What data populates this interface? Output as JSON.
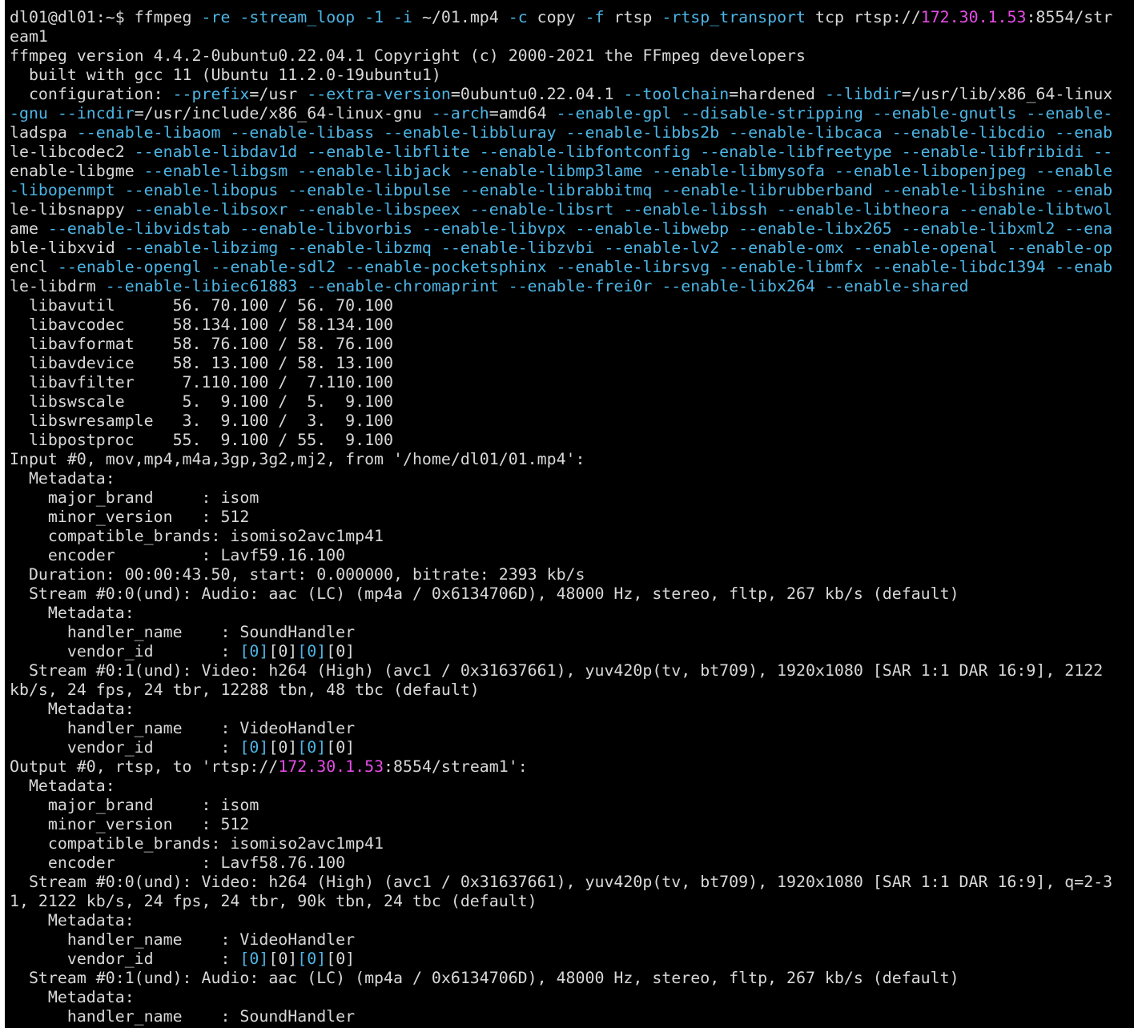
{
  "window": {
    "app": "terminal"
  },
  "colors": {
    "background": "#000000",
    "text": "#d8d8d8",
    "option_highlight": "#4cb6e6",
    "ip_highlight": "#e64ce6"
  },
  "terminal": {
    "lines": [
      [
        {
          "t": "dl01@dl01:~$ ffmpeg "
        },
        {
          "t": "-re -stream_loop -1 -i",
          "c": "opt"
        },
        {
          "t": " ~/01.mp4 "
        },
        {
          "t": "-c",
          "c": "opt"
        },
        {
          "t": " copy "
        },
        {
          "t": "-f",
          "c": "opt"
        },
        {
          "t": " rtsp "
        },
        {
          "t": "-rtsp_transport",
          "c": "opt"
        },
        {
          "t": " tcp rtsp://"
        },
        {
          "t": "172.30.1.53",
          "c": "ip"
        },
        {
          "t": ":8554/str"
        }
      ],
      [
        {
          "t": "eam1"
        }
      ],
      [
        {
          "t": "ffmpeg version 4.4.2-0ubuntu0.22.04.1 Copyright (c) 2000-2021 the FFmpeg developers"
        }
      ],
      [
        {
          "t": "  built with gcc 11 (Ubuntu 11.2.0-19ubuntu1)"
        }
      ],
      [
        {
          "t": "  configuration: "
        },
        {
          "t": "--prefix",
          "c": "opt"
        },
        {
          "t": "=/usr "
        },
        {
          "t": "--extra-version",
          "c": "opt"
        },
        {
          "t": "=0ubuntu0.22.04.1 "
        },
        {
          "t": "--toolchain",
          "c": "opt"
        },
        {
          "t": "=hardened "
        },
        {
          "t": "--libdir",
          "c": "opt"
        },
        {
          "t": "=/usr/lib/x86_64-linux"
        }
      ],
      [
        {
          "t": "-gnu --incdir",
          "c": "opt"
        },
        {
          "t": "=/usr/include/x86_64-linux-gnu "
        },
        {
          "t": "--arch",
          "c": "opt"
        },
        {
          "t": "=amd64 "
        },
        {
          "t": "--enable-gpl --disable-stripping --enable-gnutls --enable-",
          "c": "opt"
        }
      ],
      [
        {
          "t": "ladspa "
        },
        {
          "t": "--enable-libaom --enable-libass --enable-libbluray --enable-libbs2b --enable-libcaca --enable-libcdio --enab",
          "c": "opt"
        }
      ],
      [
        {
          "t": "le-libcodec2 "
        },
        {
          "t": "--enable-libdav1d --enable-libflite --enable-libfontconfig --enable-libfreetype --enable-libfribidi --",
          "c": "opt"
        }
      ],
      [
        {
          "t": "enable-libgme "
        },
        {
          "t": "--enable-libgsm --enable-libjack --enable-libmp3lame --enable-libmysofa --enable-libopenjpeg --enable",
          "c": "opt"
        }
      ],
      [
        {
          "t": "-libopenmpt --enable-libopus --enable-libpulse --enable-librabbitmq --enable-librubberband --enable-libshine --enab",
          "c": "opt"
        }
      ],
      [
        {
          "t": "le-libsnappy "
        },
        {
          "t": "--enable-libsoxr --enable-libspeex --enable-libsrt --enable-libssh --enable-libtheora --enable-libtwol",
          "c": "opt"
        }
      ],
      [
        {
          "t": "ame "
        },
        {
          "t": "--enable-libvidstab --enable-libvorbis --enable-libvpx --enable-libwebp --enable-libx265 --enable-libxml2 --ena",
          "c": "opt"
        }
      ],
      [
        {
          "t": "ble-libxvid "
        },
        {
          "t": "--enable-libzimg --enable-libzmq --enable-libzvbi --enable-lv2 --enable-omx --enable-openal --enable-op",
          "c": "opt"
        }
      ],
      [
        {
          "t": "encl "
        },
        {
          "t": "--enable-opengl --enable-sdl2 --enable-pocketsphinx --enable-librsvg --enable-libmfx --enable-libdc1394 --enab",
          "c": "opt"
        }
      ],
      [
        {
          "t": "le-libdrm "
        },
        {
          "t": "--enable-libiec61883 --enable-chromaprint --enable-frei0r --enable-libx264 --enable-shared",
          "c": "opt"
        }
      ],
      [
        {
          "t": "  libavutil      56. 70.100 / 56. 70.100"
        }
      ],
      [
        {
          "t": "  libavcodec     58.134.100 / 58.134.100"
        }
      ],
      [
        {
          "t": "  libavformat    58. 76.100 / 58. 76.100"
        }
      ],
      [
        {
          "t": "  libavdevice    58. 13.100 / 58. 13.100"
        }
      ],
      [
        {
          "t": "  libavfilter     7.110.100 /  7.110.100"
        }
      ],
      [
        {
          "t": "  libswscale      5.  9.100 /  5.  9.100"
        }
      ],
      [
        {
          "t": "  libswresample   3.  9.100 /  3.  9.100"
        }
      ],
      [
        {
          "t": "  libpostproc    55.  9.100 / 55.  9.100"
        }
      ],
      [
        {
          "t": "Input #0, mov,mp4,m4a,3gp,3g2,mj2, from '/home/dl01/01.mp4':"
        }
      ],
      [
        {
          "t": "  Metadata:"
        }
      ],
      [
        {
          "t": "    major_brand     : isom"
        }
      ],
      [
        {
          "t": "    minor_version   : 512"
        }
      ],
      [
        {
          "t": "    compatible_brands: isomiso2avc1mp41"
        }
      ],
      [
        {
          "t": "    encoder         : Lavf59.16.100"
        }
      ],
      [
        {
          "t": "  Duration: 00:00:43.50, start: 0.000000, bitrate: 2393 kb/s"
        }
      ],
      [
        {
          "t": "  Stream #0:0(und): Audio: aac (LC) (mp4a / 0x6134706D), 48000 Hz, stereo, fltp, 267 kb/s (default)"
        }
      ],
      [
        {
          "t": "    Metadata:"
        }
      ],
      [
        {
          "t": "      handler_name    : SoundHandler"
        }
      ],
      [
        {
          "t": "      vendor_id       : "
        },
        {
          "t": "[0]",
          "c": "dim"
        },
        {
          "t": "[0]"
        },
        {
          "t": "[0]",
          "c": "dim"
        },
        {
          "t": "[0]"
        }
      ],
      [
        {
          "t": "  Stream #0:1(und): Video: h264 (High) (avc1 / 0x31637661), yuv420p(tv, bt709), 1920x1080 [SAR 1:1 DAR 16:9], 2122"
        }
      ],
      [
        {
          "t": "kb/s, 24 fps, 24 tbr, 12288 tbn, 48 tbc (default)"
        }
      ],
      [
        {
          "t": "    Metadata:"
        }
      ],
      [
        {
          "t": "      handler_name    : VideoHandler"
        }
      ],
      [
        {
          "t": "      vendor_id       : "
        },
        {
          "t": "[0]",
          "c": "dim"
        },
        {
          "t": "[0]"
        },
        {
          "t": "[0]",
          "c": "dim"
        },
        {
          "t": "[0]"
        }
      ],
      [
        {
          "t": "Output #0, rtsp, to 'rtsp://"
        },
        {
          "t": "172.30.1.53",
          "c": "ip"
        },
        {
          "t": ":8554/stream1':"
        }
      ],
      [
        {
          "t": "  Metadata:"
        }
      ],
      [
        {
          "t": "    major_brand     : isom"
        }
      ],
      [
        {
          "t": "    minor_version   : 512"
        }
      ],
      [
        {
          "t": "    compatible_brands: isomiso2avc1mp41"
        }
      ],
      [
        {
          "t": "    encoder         : Lavf58.76.100"
        }
      ],
      [
        {
          "t": "  Stream #0:0(und): Video: h264 (High) (avc1 / 0x31637661), yuv420p(tv, bt709), 1920x1080 [SAR 1:1 DAR 16:9], q=2-3"
        }
      ],
      [
        {
          "t": "1, 2122 kb/s, 24 fps, 24 tbr, 90k tbn, 24 tbc (default)"
        }
      ],
      [
        {
          "t": "    Metadata:"
        }
      ],
      [
        {
          "t": "      handler_name    : VideoHandler"
        }
      ],
      [
        {
          "t": "      vendor_id       : "
        },
        {
          "t": "[0]",
          "c": "dim"
        },
        {
          "t": "[0]"
        },
        {
          "t": "[0]",
          "c": "dim"
        },
        {
          "t": "[0]"
        }
      ],
      [
        {
          "t": "  Stream #0:1(und): Audio: aac (LC) (mp4a / 0x6134706D), 48000 Hz, stereo, fltp, 267 kb/s (default)"
        }
      ],
      [
        {
          "t": "    Metadata:"
        }
      ],
      [
        {
          "t": "      handler_name    : SoundHandler"
        }
      ]
    ]
  }
}
